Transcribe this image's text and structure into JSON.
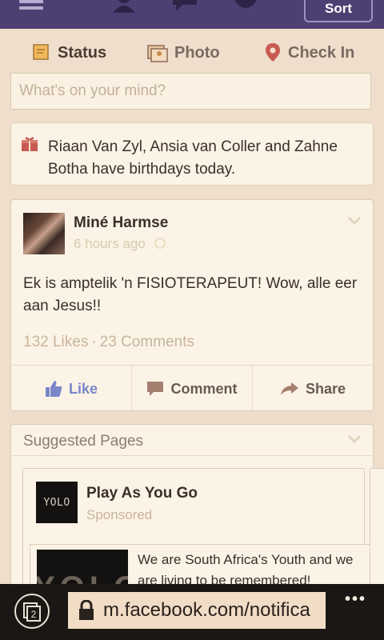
{
  "topbar": {
    "sort_label": "Sort"
  },
  "composer": {
    "tabs": [
      {
        "label": "Status"
      },
      {
        "label": "Photo"
      },
      {
        "label": "Check In"
      }
    ],
    "placeholder": "What's on your mind?"
  },
  "birthday": {
    "text": "Riaan Van Zyl, Ansia van Coller and Zahne Botha have birthdays today."
  },
  "post": {
    "author": "Miné Harmse",
    "time": "6 hours ago",
    "body": "Ek is amptelik 'n FISIOTERAPEUT! Wow, alle eer aan Jesus!!",
    "likes": "132 Likes",
    "separator": "·",
    "comments": "23 Comments",
    "actions": {
      "like": "Like",
      "comment": "Comment",
      "share": "Share"
    }
  },
  "suggested": {
    "title": "Suggested Pages",
    "page": {
      "logo_text": "YOLO",
      "name": "Play As You Go",
      "sponsored": "Sponsored",
      "banner_text": "YOLO",
      "description": "We are South Africa's Youth and we are living to be remembered!"
    }
  },
  "browser": {
    "url": "m.facebook.com/notifica"
  },
  "colors": {
    "nav": "#4e3f72",
    "background": "#eedecb",
    "card": "#fbf3e6",
    "like": "#7a86c8"
  }
}
